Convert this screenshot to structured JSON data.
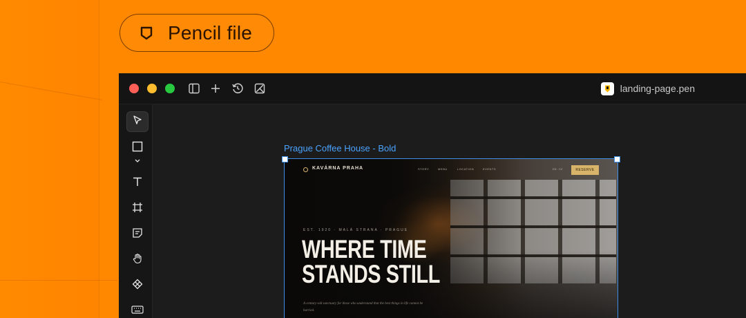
{
  "colors": {
    "background": "#ff8800",
    "pill_border": "#7a3d00",
    "app_bg": "#1a1a1a",
    "selection": "#3d8fe8",
    "traffic_red": "#ff5f57",
    "traffic_yellow": "#febc2e",
    "traffic_green": "#28c840",
    "cta_gold": "#d7b46a"
  },
  "badge": {
    "label": "Pencil file",
    "icon": "pencil-tag-icon"
  },
  "window": {
    "file_name": "landing-page.pen",
    "file_icon": "pencil-app-icon",
    "title_icons": [
      "sidebar-toggle-icon",
      "plus-icon",
      "history-icon",
      "components-icon"
    ]
  },
  "toolbar": {
    "tools": [
      "select-arrow-icon",
      "rectangle-icon",
      "chevron-down-icon",
      "text-icon",
      "frame-icon",
      "sticky-note-icon",
      "hand-icon",
      "component-diamond-icon",
      "keyboard-icon"
    ]
  },
  "canvas": {
    "frame_label": "Prague Coffee House - Bold",
    "site": {
      "brand": "KAVÁRNA PRAHA",
      "nav": [
        "STORY",
        "MENU",
        "LOCATION",
        "EVENTS"
      ],
      "lang": "EN · CZ",
      "cta": "RESERVE",
      "eyebrow": "EST. 1920 · MALÁ STRANA · PRAGUE",
      "headline_line1": "WHERE TIME",
      "headline_line2": "STANDS STILL",
      "copy": "A century-old sanctuary for those who understand that the best things in life cannot be hurried."
    }
  }
}
